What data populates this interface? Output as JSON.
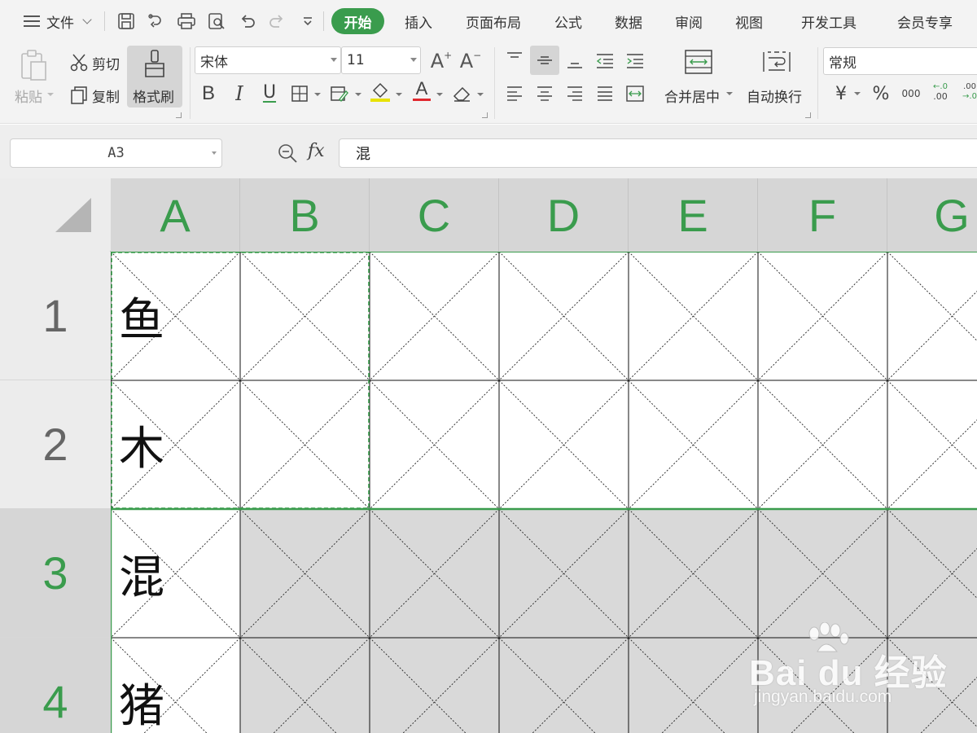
{
  "menubar": {
    "file_label": "文件",
    "tabs": [
      {
        "label": "开始",
        "active": true
      },
      {
        "label": "插入"
      },
      {
        "label": "页面布局"
      },
      {
        "label": "公式"
      },
      {
        "label": "数据"
      },
      {
        "label": "审阅"
      },
      {
        "label": "视图"
      },
      {
        "label": "开发工具"
      },
      {
        "label": "会员专享"
      }
    ],
    "quick_icons": [
      "save-icon",
      "export-icon",
      "print-icon",
      "print-preview-icon",
      "undo-icon",
      "redo-icon",
      "customize-icon"
    ]
  },
  "ribbon": {
    "paste_label": "粘贴",
    "cut_label": "剪切",
    "copy_label": "复制",
    "format_painter_label": "格式刷",
    "font_name": "宋体",
    "font_size": "11",
    "grow_font_label": "A",
    "shrink_font_label": "A",
    "bold_label": "B",
    "italic_label": "I",
    "underline_label": "U",
    "font_color_label": "A",
    "merge_center_label": "合并居中",
    "wrap_text_label": "自动换行",
    "number_format": "常规",
    "currency_label": "¥",
    "percent_label": "%",
    "thousands_label": "000",
    "increase_decimal_label": ".00",
    "decrease_decimal_label": ".00"
  },
  "formula_bar": {
    "name_box": "A3",
    "fx_label": "fx",
    "formula": "混"
  },
  "sheet": {
    "columns": [
      "A",
      "B",
      "C",
      "D",
      "E",
      "F",
      "G"
    ],
    "rows": [
      "1",
      "2",
      "3",
      "4"
    ],
    "active_row": "3",
    "cells": {
      "A1": "鱼",
      "A2": "木",
      "A3": "混",
      "A4": "猪"
    }
  },
  "watermark": {
    "brand": "Bai du 经验",
    "url": "jingyan.baidu.com"
  },
  "colors": {
    "accent": "#3a9c4d",
    "toolbar_bg": "#f3f3f3",
    "header_bg": "#d6d6d6",
    "selection_bg": "#d9d9d9"
  }
}
